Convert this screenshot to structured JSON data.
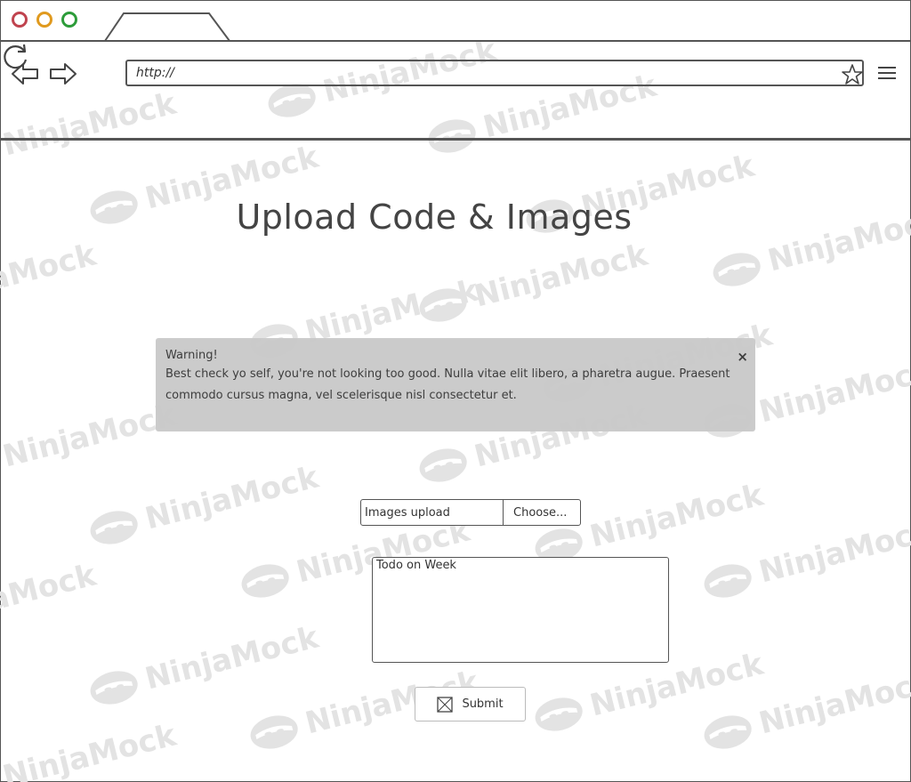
{
  "browser": {
    "address_value": "http://",
    "window_controls": [
      "close-dot",
      "minimize-dot",
      "maximize-dot"
    ],
    "icons": [
      "back-arrow-icon",
      "forward-arrow-icon",
      "reload-icon",
      "bookmark-star-icon",
      "hamburger-menu-icon"
    ]
  },
  "watermark": {
    "text": "NinjaMock"
  },
  "page": {
    "title": "Upload Code & Images"
  },
  "alert": {
    "title": "Warning!",
    "body": "Best check yo self, you're not looking too good. Nulla vitae elit libero, a pharetra augue. Praesent commodo cursus magna, vel scelerisque nisl consectetur et.",
    "close_label": "×",
    "color": "#c9c9c9"
  },
  "upload": {
    "label": "Images upload",
    "button_label": "Choose..."
  },
  "todo": {
    "value": "Todo on Week"
  },
  "submit": {
    "label": "Submit",
    "icon": "image-placeholder-icon"
  }
}
